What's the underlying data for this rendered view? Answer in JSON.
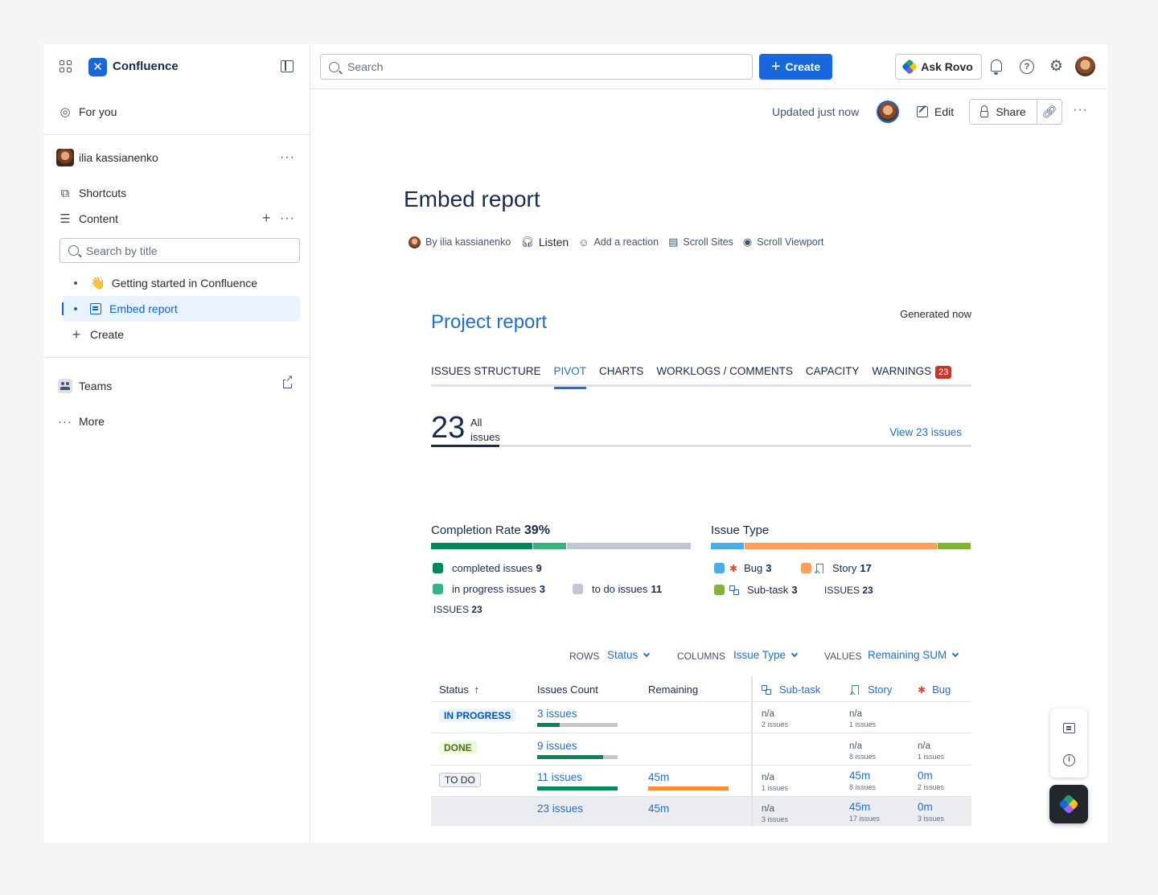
{
  "sidebar": {
    "app_name": "Confluence",
    "for_you": "For you",
    "user_name": "ilia kassianenko",
    "shortcuts": "Shortcuts",
    "content": "Content",
    "search_placeholder": "Search by title",
    "tree": [
      {
        "emoji": "👋",
        "label": "Getting started in Confluence"
      },
      {
        "label": "Embed report"
      }
    ],
    "create": "Create",
    "teams": "Teams",
    "more": "More"
  },
  "topbar": {
    "search_placeholder": "Search",
    "create_label": "Create",
    "ask_rovo": "Ask Rovo"
  },
  "page_tools": {
    "updated": "Updated just now",
    "edit": "Edit",
    "share": "Share"
  },
  "page": {
    "title": "Embed report",
    "byline": "By ilia kassianenko",
    "listen": "Listen",
    "add_reaction": "Add a reaction",
    "scroll_sites": "Scroll Sites",
    "scroll_viewport": "Scroll Viewport"
  },
  "report": {
    "title": "Project report",
    "generated": "Generated now",
    "tabs": [
      {
        "label": "ISSUES STRUCTURE"
      },
      {
        "label": "PIVOT",
        "active": true
      },
      {
        "label": "CHARTS"
      },
      {
        "label": "WORKLOGS / COMMENTS"
      },
      {
        "label": "CAPACITY"
      },
      {
        "label": "WARNINGS",
        "badge": "23"
      }
    ],
    "total_count": "23",
    "total_label_1": "All",
    "total_label_2": "issues",
    "view_link": "View 23 issues",
    "completion": {
      "title": "Completion Rate",
      "rate": "39%",
      "completed_label": "completed issues",
      "completed": "9",
      "in_progress_label": "in progress issues",
      "in_progress": "3",
      "todo_label": "to do issues",
      "todo": "11",
      "issues_label": "ISSUES",
      "issues_total": "23",
      "colors": {
        "completed": "#00875a",
        "in_progress": "#36b37e",
        "todo": "#c1c7d0"
      }
    },
    "issue_type": {
      "title": "Issue Type",
      "bug_label": "Bug",
      "bug": "3",
      "story_label": "Story",
      "story": "17",
      "subtask_label": "Sub-task",
      "subtask": "3",
      "issues_label": "ISSUES",
      "issues_total": "23",
      "colors": {
        "bug": "#4bade8",
        "story": "#ff9f5a",
        "subtask": "#82b536"
      }
    },
    "controls": {
      "rows_label": "ROWS",
      "rows_value": "Status",
      "columns_label": "COLUMNS",
      "columns_value": "Issue Type",
      "values_label": "VALUES",
      "values_value": "Remaining SUM"
    },
    "table": {
      "headers": {
        "status": "Status",
        "issues_count": "Issues Count",
        "remaining": "Remaining",
        "subtask": "Sub-task",
        "story": "Story",
        "bug": "Bug"
      },
      "rows": [
        {
          "status": "IN PROGRESS",
          "count": "3 issues",
          "remaining": "",
          "subtask": {
            "v": "n/a",
            "s": "2 issues"
          },
          "story": {
            "v": "n/a",
            "s": "1 issues"
          },
          "bug": {
            "v": "",
            "s": ""
          }
        },
        {
          "status": "DONE",
          "count": "9 issues",
          "remaining": "",
          "subtask": {
            "v": "",
            "s": ""
          },
          "story": {
            "v": "n/a",
            "s": "8 issues"
          },
          "bug": {
            "v": "n/a",
            "s": "1 issues"
          }
        },
        {
          "status": "TO DO",
          "count": "11 issues",
          "remaining": "45m",
          "subtask": {
            "v": "n/a",
            "s": "1 issues"
          },
          "story": {
            "v": "45m",
            "s": "8 issues"
          },
          "bug": {
            "v": "0m",
            "s": "2 issues"
          }
        }
      ],
      "total": {
        "count": "23 issues",
        "remaining": "45m",
        "subtask": {
          "v": "n/a",
          "s": "3 issues"
        },
        "story": {
          "v": "45m",
          "s": "17 issues"
        },
        "bug": {
          "v": "0m",
          "s": "3 issues"
        }
      }
    }
  }
}
